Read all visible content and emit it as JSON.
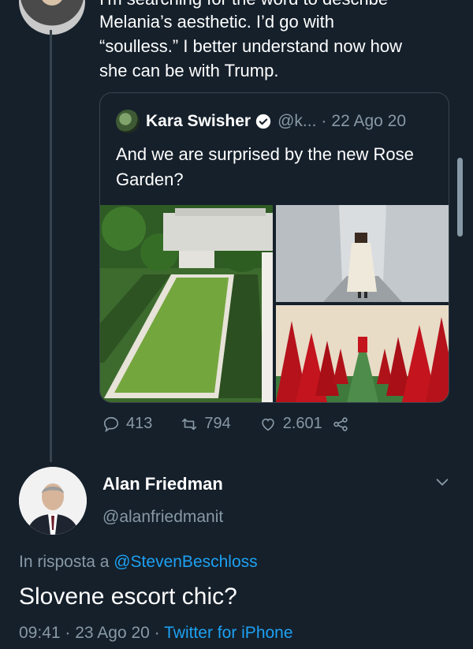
{
  "parent_tweet": {
    "cut_line": "I'm searching for the word to describe",
    "lines": [
      "Melania’s aesthetic. I’d go with",
      "“soulless.” I better understand now how",
      "she can be with Trump."
    ]
  },
  "quote": {
    "name": "Kara Swisher",
    "handle": "@k...",
    "dot": "·",
    "date": "22 Ago 20",
    "text": "And we are surprised by the new Rose Garden?"
  },
  "actions": {
    "replies": "413",
    "retweets": "794",
    "likes": "2.601"
  },
  "reply": {
    "author_name": "Alan Friedman",
    "author_handle": "@alanfriedmanit",
    "reply_prefix": "In risposta a ",
    "reply_to": "@StevenBeschloss",
    "text": "Slovene escort chic?",
    "time": "09:41",
    "date": "23 Ago 20",
    "sep": " · ",
    "source": "Twitter for iPhone"
  },
  "colors": {
    "background": "#15202b",
    "secondary_text": "#8899a6",
    "link": "#1da1f2",
    "verified": "#1da1f2"
  }
}
